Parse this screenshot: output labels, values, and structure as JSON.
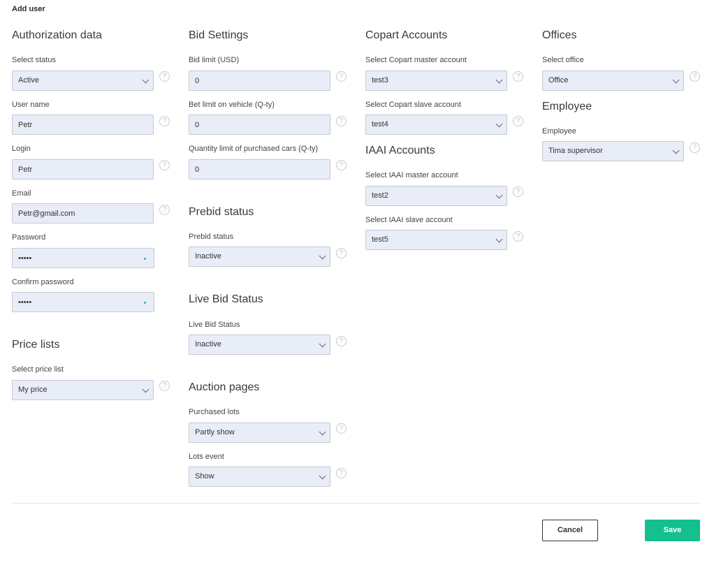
{
  "page_title": "Add user",
  "authorization": {
    "title": "Authorization data",
    "status_label": "Select status",
    "status_value": "Active",
    "username_label": "User name",
    "username_value": "Petr",
    "login_label": "Login",
    "login_value": "Petr",
    "email_label": "Email",
    "email_value": "Petr@gmail.com",
    "password_label": "Password",
    "password_value": "•••••",
    "confirm_label": "Confirm password",
    "confirm_value": "•••••"
  },
  "price_lists": {
    "title": "Price lists",
    "label": "Select price list",
    "value": "My price"
  },
  "bid_settings": {
    "title": "Bid Settings",
    "bid_limit_label": "Bid limit (USD)",
    "bid_limit_value": "0",
    "bet_limit_label": "Bet limit on vehicle (Q-ty)",
    "bet_limit_value": "0",
    "qty_limit_label": "Quantity limit of purchased cars (Q-ty)",
    "qty_limit_value": "0"
  },
  "prebid": {
    "title": "Prebid status",
    "label": "Prebid status",
    "value": "Inactive"
  },
  "live_bid": {
    "title": "Live Bid Status",
    "label": "Live Bid Status",
    "value": "Inactive"
  },
  "auction_pages": {
    "title": "Auction pages",
    "purchased_label": "Purchased lots",
    "purchased_value": "Partly show",
    "lots_event_label": "Lots event",
    "lots_event_value": "Show"
  },
  "copart": {
    "title": "Copart Accounts",
    "master_label": "Select Copart master account",
    "master_value": "test3",
    "slave_label": "Select Copart slave account",
    "slave_value": "test4"
  },
  "iaai": {
    "title": "IAAI Accounts",
    "master_label": "Select IAAI master account",
    "master_value": "test2",
    "slave_label": "Select IAAI slave account",
    "slave_value": "test5"
  },
  "offices": {
    "title": "Offices",
    "label": "Select office",
    "value": "Office"
  },
  "employee": {
    "title": "Employee",
    "label": "Employee",
    "value": "Tima supervisor"
  },
  "help_glyph": "?",
  "actions": {
    "cancel_label": "Cancel",
    "save_label": "Save"
  }
}
